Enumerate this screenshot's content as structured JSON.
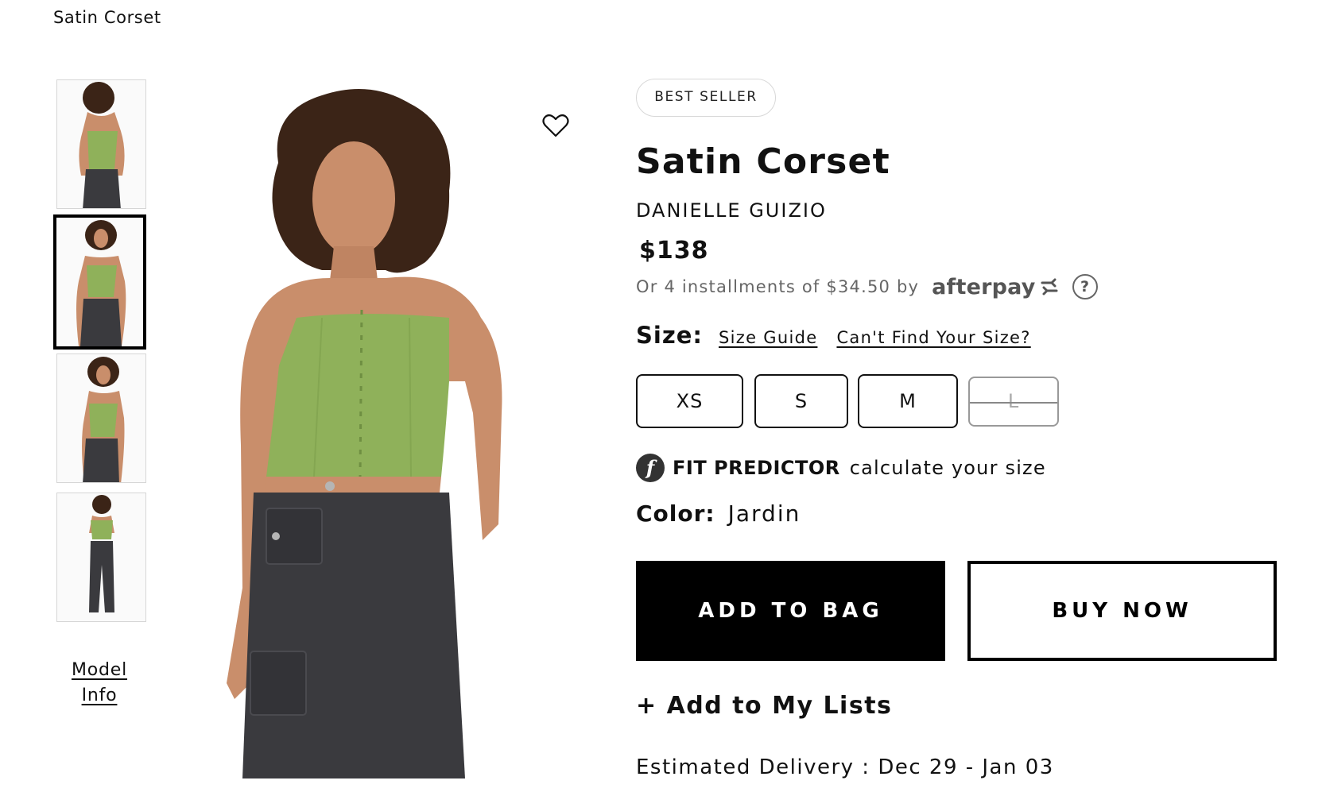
{
  "breadcrumb": "Satin Corset",
  "gallery": {
    "model_info_line1": "Model",
    "model_info_line2": "Info",
    "thumbnails": [
      "back view",
      "front view",
      "three-quarter view",
      "full length view"
    ],
    "selected_index": 1
  },
  "product": {
    "badge": "BEST SELLER",
    "title": "Satin Corset",
    "brand": "DANIELLE GUIZIO",
    "price": "$138",
    "installments_text": "Or 4 installments of $34.50 by",
    "afterpay_logo": "afterpay",
    "help_icon": "?"
  },
  "size": {
    "label": "Size:",
    "guide_link": "Size Guide",
    "cant_find_link": "Can't Find Your Size?",
    "options": [
      "XS",
      "S",
      "M",
      "L"
    ],
    "unavailable": [
      "L"
    ]
  },
  "fit_predictor": {
    "icon": "f",
    "brand": "FIT PREDICTOR",
    "text": "calculate your size"
  },
  "color": {
    "label": "Color:",
    "value": "Jardin"
  },
  "actions": {
    "add_to_bag": "ADD TO BAG",
    "buy_now": "BUY NOW",
    "add_to_lists": "+ Add to My Lists"
  },
  "delivery": "Estimated Delivery : Dec 29 - Jan 03",
  "colors": {
    "corset_green": "#8fb15a",
    "jeans_dark": "#3a3a3e",
    "skin": "#c98e6b",
    "hair": "#3b2417"
  }
}
